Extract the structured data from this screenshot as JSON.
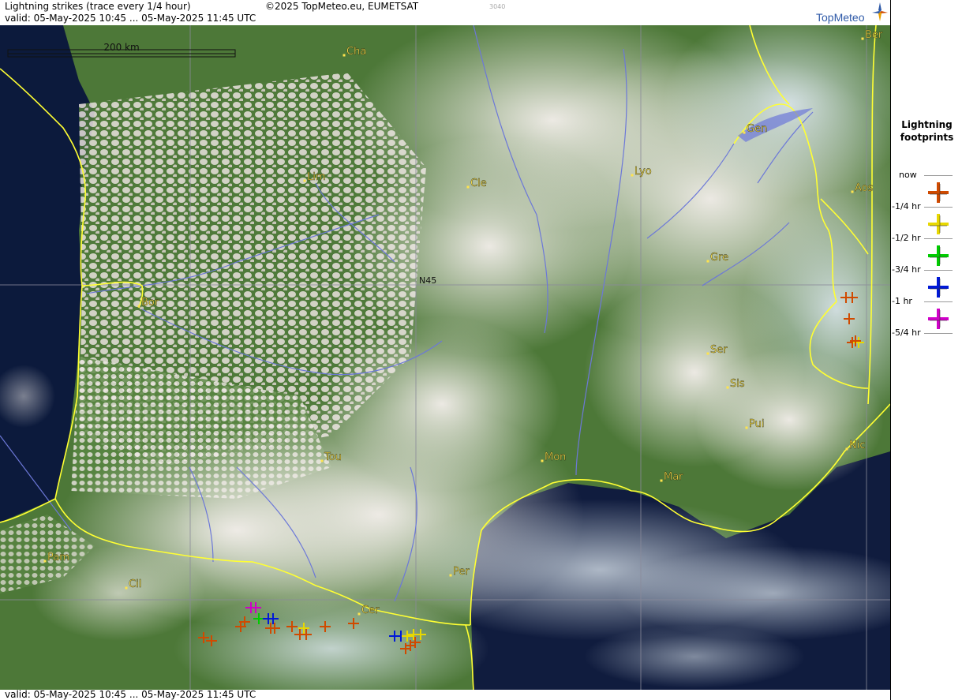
{
  "header": {
    "title": "Lightning strikes (trace every 1/4 hour)",
    "copyright": "©2025 TopMeteo.eu, EUMETSAT",
    "code": "3040",
    "valid": "valid:  05-May-2025 10:45 ... 05-May-2025 11:45 UTC"
  },
  "logo": {
    "text": "TopMeteo"
  },
  "scale": {
    "label": "200 km"
  },
  "grid": {
    "label": "N45"
  },
  "colors": {
    "coast": "#ffff33",
    "rivers": "#6c78d8",
    "city_label": "#ffe44d",
    "strike_now": "#d04a00",
    "strike_quarter": "#e8d800",
    "strike_half": "#00cc00",
    "strike_three_quarter": "#0018d8",
    "strike_hour": "#d000c8"
  },
  "cities": [
    {
      "name": "Cha"
    },
    {
      "name": "Ber"
    },
    {
      "name": "Gen"
    },
    {
      "name": "Lim"
    },
    {
      "name": "Cle"
    },
    {
      "name": "Lyo"
    },
    {
      "name": "Aos"
    },
    {
      "name": "Gre"
    },
    {
      "name": "Bor"
    },
    {
      "name": "Ser"
    },
    {
      "name": "Sis"
    },
    {
      "name": "Pui"
    },
    {
      "name": "Tou"
    },
    {
      "name": "Mon"
    },
    {
      "name": "Mar"
    },
    {
      "name": "Nic"
    },
    {
      "name": "Pam"
    },
    {
      "name": "Cil"
    },
    {
      "name": "Per"
    },
    {
      "name": "Cer"
    }
  ],
  "legend": {
    "title_line1": "Lightning",
    "title_line2": "footprints",
    "ticks": [
      "now",
      "-1/4 hr",
      "-1/2 hr",
      "-3/4 hr",
      "-1 hr",
      "-5/4 hr"
    ]
  },
  "footer": {
    "valid": "valid:  05-May-2025 10:45 ... 05-May-2025 11:45 UTC"
  }
}
